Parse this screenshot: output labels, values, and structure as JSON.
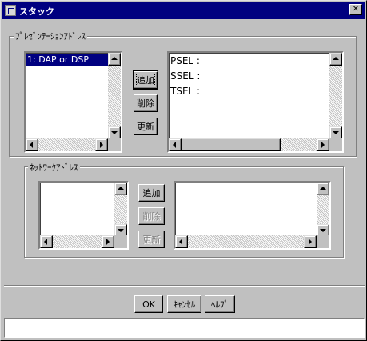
{
  "window": {
    "title": "スタック",
    "close_label": "✕"
  },
  "presentation": {
    "legend": "ﾌﾟﾚｾﾞﾝﾃｰｼｮﾝｱﾄﾞﾚｽ",
    "items": [
      {
        "label": "1: DAP or DSP",
        "selected": true
      }
    ],
    "buttons": {
      "add": "追加",
      "delete": "削除",
      "update": "更新"
    },
    "details": [
      "PSEL :",
      "SSEL :",
      "TSEL :"
    ]
  },
  "network": {
    "legend": "ﾈｯﾄﾜｰｸｱﾄﾞﾚｽ",
    "items": [],
    "buttons": {
      "add": "追加",
      "delete": "削除",
      "update": "更新"
    }
  },
  "footer": {
    "ok": "OK",
    "cancel": "ｷｬﾝｾﾙ",
    "help": "ﾍﾙﾌﾟ"
  },
  "status": {
    "text": ""
  },
  "colors": {
    "titlebar": "#000080",
    "selection": "#000080",
    "face": "#c0c0c0"
  }
}
